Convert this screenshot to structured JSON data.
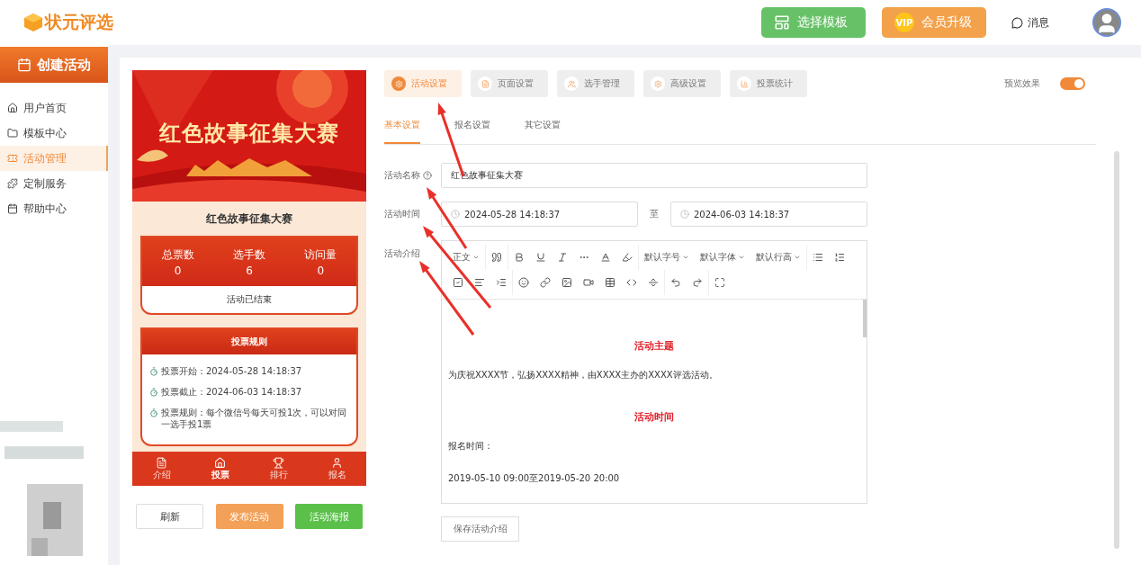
{
  "header": {
    "logo": "状元评选",
    "buttons": [
      {
        "kind": "template",
        "label": "选择模板"
      },
      {
        "kind": "vip",
        "label": "会员升级",
        "badge": "VIP"
      }
    ],
    "messages": "消息"
  },
  "sidebar": {
    "create": "创建活动",
    "items": [
      {
        "label": "用户首页",
        "selected": false
      },
      {
        "label": "模板中心",
        "selected": false
      },
      {
        "label": "活动管理",
        "selected": true
      },
      {
        "label": "定制服务",
        "selected": false
      },
      {
        "label": "帮助中心",
        "selected": false
      }
    ]
  },
  "preview": {
    "banner_title": "红色故事征集大赛",
    "title": "红色故事征集大赛",
    "stats": [
      {
        "label": "总票数",
        "value": "0"
      },
      {
        "label": "选手数",
        "value": "6"
      },
      {
        "label": "访问量",
        "value": "0"
      }
    ],
    "status": "活动已结束",
    "rules_title": "投票规则",
    "rules": [
      "投票开始：2024-05-28 14:18:37",
      "投票截止：2024-06-03 14:18:37",
      "投票规则：每个微信号每天可投1次，可以对同一选手投1票"
    ],
    "nav": [
      {
        "label": "介绍",
        "selected": false
      },
      {
        "label": "投票",
        "selected": true
      },
      {
        "label": "排行",
        "selected": false
      },
      {
        "label": "报名",
        "selected": false
      }
    ],
    "buttons": [
      {
        "kind": "plain",
        "label": "刷新"
      },
      {
        "kind": "orange",
        "label": "发布活动"
      },
      {
        "kind": "green",
        "label": "活动海报"
      }
    ]
  },
  "settings": {
    "tabs": [
      {
        "label": "活动设置",
        "selected": true
      },
      {
        "label": "页面设置",
        "selected": false
      },
      {
        "label": "选手管理",
        "selected": false
      },
      {
        "label": "高级设置",
        "selected": false
      },
      {
        "label": "投票统计",
        "selected": false
      }
    ],
    "preview_toggle": {
      "label": "预览效果",
      "on": true
    },
    "subtabs": [
      {
        "label": "基本设置",
        "selected": true
      },
      {
        "label": "报名设置",
        "selected": false
      },
      {
        "label": "其它设置",
        "selected": false
      }
    ],
    "name_label": "活动名称",
    "name_value": "红色故事征集大赛",
    "time_label": "活动时间",
    "start": "2024-05-28 14:18:37",
    "separator": "至",
    "end": "2024-06-03 14:18:37",
    "intro_label": "活动介绍",
    "toolbar_labels": [
      "正文",
      "默认字号",
      "默认字体",
      "默认行高"
    ],
    "content": [
      {
        "kind": "heading",
        "text": "活动主题"
      },
      {
        "kind": "para",
        "text": "为庆祝XXXX节，弘扬XXXX精神，由XXXX主办的XXXX评选活动。"
      },
      {
        "kind": "heading",
        "text": "活动时间"
      },
      {
        "kind": "para",
        "text": "报名时间："
      },
      {
        "kind": "para",
        "text": "2019-05-10 09:00至2019-05-20 20:00"
      }
    ],
    "save": "保存活动介绍"
  }
}
